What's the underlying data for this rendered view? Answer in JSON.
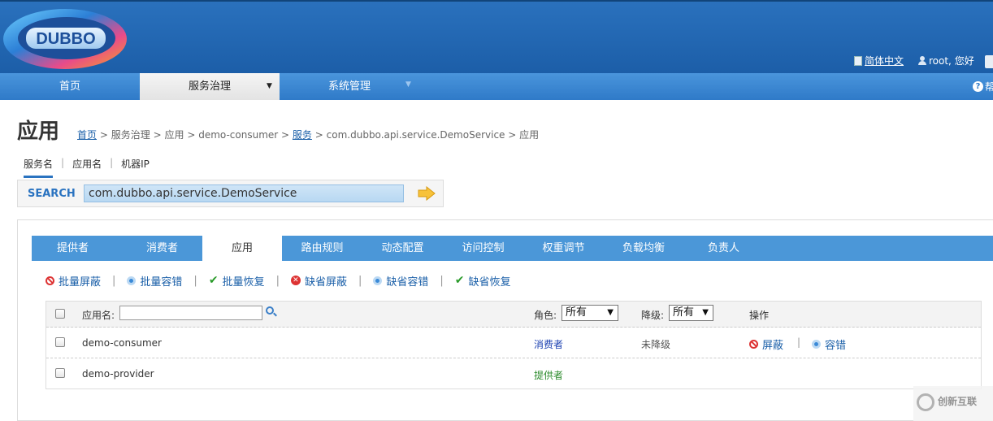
{
  "header": {
    "logo_text": "DUBBO",
    "language_link": "简体中文",
    "user_greeting": "root, 您好"
  },
  "nav": {
    "items": [
      {
        "label": "首页"
      },
      {
        "label": "服务治理"
      },
      {
        "label": "系统管理"
      }
    ],
    "help_label": "帮"
  },
  "page": {
    "title": "应用",
    "breadcrumb": {
      "home": "首页",
      "sep": ">",
      "governance": "服务治理",
      "app": "应用",
      "consumer": "demo-consumer",
      "service": "服务",
      "interface": "com.dubbo.api.service.DemoService",
      "last": "应用"
    }
  },
  "search": {
    "tabs": [
      "服务名",
      "应用名",
      "机器IP"
    ],
    "label": "SEARCH",
    "value": "com.dubbo.api.service.DemoService"
  },
  "tabs": [
    "提供者",
    "消费者",
    "应用",
    "路由规则",
    "动态配置",
    "访问控制",
    "权重调节",
    "负载均衡",
    "负责人"
  ],
  "actions": [
    "批量屏蔽",
    "批量容错",
    "批量恢复",
    "缺省屏蔽",
    "缺省容错",
    "缺省恢复"
  ],
  "table": {
    "app_name_label": "应用名:",
    "role_label": "角色:",
    "role_value": "所有",
    "degrade_label": "降级:",
    "degrade_value": "所有",
    "ops_label": "操作",
    "rows": [
      {
        "name": "demo-consumer",
        "role": "消费者",
        "status": "未降级",
        "act1": "屏蔽",
        "act2": "容错"
      },
      {
        "name": "demo-provider",
        "role": "提供者",
        "status": "",
        "act1": "",
        "act2": ""
      }
    ]
  },
  "watermark": "创新互联"
}
